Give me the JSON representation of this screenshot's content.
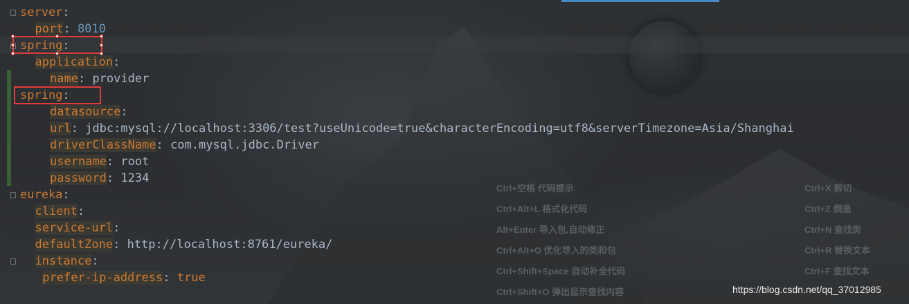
{
  "editor": {
    "lines": [
      {
        "indent": 0,
        "key": "server",
        "sep": ":",
        "value": ""
      },
      {
        "indent": 1,
        "key": "port",
        "sep": ":",
        "value": " 8010",
        "value_type": "number"
      },
      {
        "indent": 0,
        "key": "spring",
        "sep": ":",
        "value": ""
      },
      {
        "indent": 1,
        "key": "application",
        "sep": ":",
        "value": ""
      },
      {
        "indent": 2,
        "key": "name",
        "sep": ":",
        "value": " provider"
      },
      {
        "indent": 0,
        "key": "spring",
        "sep": ":",
        "value": ""
      },
      {
        "indent": 2,
        "key": "datasource",
        "sep": ":",
        "value": ""
      },
      {
        "indent": 2,
        "key": "url",
        "sep": ":",
        "value": " jdbc:mysql://localhost:3306/test?useUnicode=true&characterEncoding=utf8&serverTimezone=Asia/Shanghai"
      },
      {
        "indent": 2,
        "key": "driverClassName",
        "sep": ":",
        "value": " com.mysql.jdbc.Driver"
      },
      {
        "indent": 2,
        "key": "username",
        "sep": ":",
        "value": " root"
      },
      {
        "indent": 2,
        "key": "password",
        "sep": ":",
        "value": " 1234"
      },
      {
        "indent": 0,
        "key": "eureka",
        "sep": ":",
        "value": ""
      },
      {
        "indent": 1,
        "key": "client",
        "sep": ":",
        "value": ""
      },
      {
        "indent": 1,
        "key": "service-url",
        "sep": ":",
        "value": ""
      },
      {
        "indent": 1,
        "key": "defaultZone",
        "sep": ":",
        "value": " http://localhost:8761/eureka/"
      },
      {
        "indent": 1,
        "key": "instance",
        "sep": ":",
        "value": ""
      },
      {
        "indent": 1.5,
        "key": "prefer-ip-address",
        "sep": ":",
        "value": " true",
        "value_type": "keyword"
      }
    ]
  },
  "shortcuts": {
    "left": [
      "Ctrl+空格  代码提示",
      "Ctrl+Alt+L  格式化代码",
      "Alt+Enter 导入包,自动修正",
      "Ctrl+Alt+O  优化导入的类和包",
      "Ctrl+Shift+Space 自动补全代码",
      "Ctrl+Shift+O  弹出显示查找内容"
    ],
    "right": [
      "Ctrl+X  剪切",
      "Ctrl+Z  倒退",
      "Ctrl+N  查找类",
      "Ctrl+R 替换文本",
      "Ctrl+F 查找文本",
      ""
    ]
  },
  "watermark": "https://blog.csdn.net/qq_37012985",
  "colors": {
    "key": "#cc7832",
    "text": "#a9b7c6",
    "number": "#6897bb",
    "annotation": "#e23b3b",
    "tab_accent": "#4a88c7"
  }
}
